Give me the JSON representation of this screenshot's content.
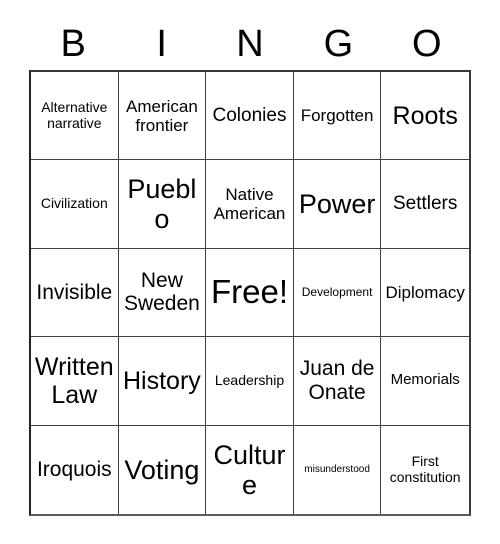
{
  "card": {
    "title": "BINGO",
    "columns": [
      "B",
      "I",
      "N",
      "G",
      "O"
    ],
    "free_space_index": 12,
    "colors": {
      "text": "#000000",
      "background": "#ffffff",
      "border": "#404040"
    },
    "cells": [
      {
        "text": "Alternative narrative",
        "size": "fs-s"
      },
      {
        "text": "American frontier",
        "size": "fs-m"
      },
      {
        "text": "Colonies",
        "size": "fs-ml"
      },
      {
        "text": "Forgotten",
        "size": "fs-m"
      },
      {
        "text": "Roots",
        "size": "fs-xl"
      },
      {
        "text": "Civilization",
        "size": "fs-s"
      },
      {
        "text": "Pueblo",
        "size": "fs-xxl"
      },
      {
        "text": "Native American",
        "size": "fs-m"
      },
      {
        "text": "Power",
        "size": "fs-xxl"
      },
      {
        "text": "Settlers",
        "size": "fs-ml"
      },
      {
        "text": "Invisible",
        "size": "fs-l"
      },
      {
        "text": "New Sweden",
        "size": "fs-l"
      },
      {
        "text": "Free!",
        "size": "fs-huge"
      },
      {
        "text": "Development",
        "size": "fs-xs"
      },
      {
        "text": "Diplomacy",
        "size": "fs-m"
      },
      {
        "text": "Written Law",
        "size": "fs-xl"
      },
      {
        "text": "History",
        "size": "fs-xl"
      },
      {
        "text": "Leadership",
        "size": "fs-s"
      },
      {
        "text": "Juan de Onate",
        "size": "fs-l"
      },
      {
        "text": "Memorials",
        "size": "fs-sm"
      },
      {
        "text": "Iroquois",
        "size": "fs-l"
      },
      {
        "text": "Voting",
        "size": "fs-xxl"
      },
      {
        "text": "Culture",
        "size": "fs-xxl"
      },
      {
        "text": "misunderstood",
        "size": "fs-xxs"
      },
      {
        "text": "First constitution",
        "size": "fs-s"
      }
    ]
  }
}
